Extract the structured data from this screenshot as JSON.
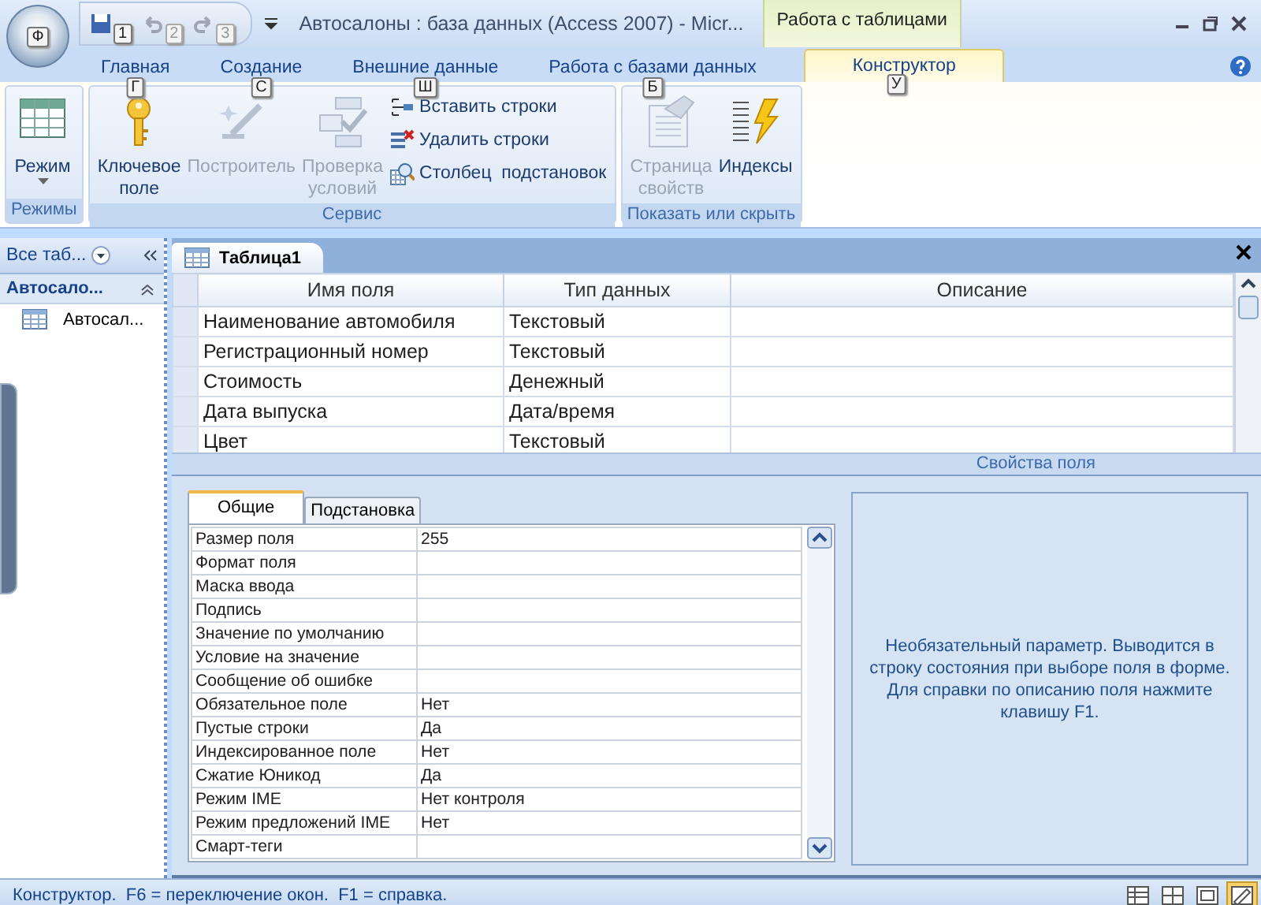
{
  "title_bar": {
    "office_keytip": "Ф",
    "quick_access": [
      {
        "keytip": "1",
        "disabled": false
      },
      {
        "keytip": "2",
        "disabled": true
      },
      {
        "keytip": "3",
        "disabled": true
      }
    ],
    "title": "Автосалоны : база данных (Access 2007) - Micr...",
    "context_tab": "Работа с таблицами"
  },
  "ribbon_tabs": [
    {
      "label": "Главная",
      "keytip": "Г",
      "selected": false
    },
    {
      "label": "Создание",
      "keytip": "С",
      "selected": false
    },
    {
      "label": "Внешние данные",
      "keytip": "Ш",
      "selected": false
    },
    {
      "label": "Работа с базами данных",
      "keytip": "Б",
      "selected": false
    },
    {
      "label": "Конструктор",
      "keytip": "У",
      "selected": true
    }
  ],
  "ribbon_groups": [
    {
      "name": "Режимы",
      "buttons": [
        {
          "kind": "dropdown",
          "label": "Режим",
          "disabled": false
        }
      ]
    },
    {
      "name": "Сервис",
      "buttons": [
        {
          "kind": "large",
          "label": "Ключевое поле",
          "disabled": false
        },
        {
          "kind": "large",
          "label": "Построитель",
          "disabled": true
        },
        {
          "kind": "large",
          "label": "Проверка условий",
          "disabled": true
        },
        {
          "kind": "small",
          "label": "Вставить строки",
          "disabled": false
        },
        {
          "kind": "small",
          "label": "Удалить строки",
          "disabled": false
        },
        {
          "kind": "small",
          "label": "Столбец  подстановок",
          "disabled": false
        }
      ]
    },
    {
      "name": "Показать или скрыть",
      "buttons": [
        {
          "kind": "large",
          "label": "Страница свойств",
          "disabled": true
        },
        {
          "kind": "large",
          "label": "Индексы",
          "disabled": false
        }
      ]
    }
  ],
  "nav_pane": {
    "header": "Все таб...",
    "group": "Автосало...",
    "items": [
      "Автосал..."
    ]
  },
  "document_tab": "Таблица1",
  "field_grid": {
    "columns": [
      "Имя поля",
      "Тип данных",
      "Описание"
    ],
    "rows": [
      {
        "name": "Наименование автомобиля",
        "type": "Текстовый"
      },
      {
        "name": "Регистрационный номер",
        "type": "Текстовый"
      },
      {
        "name": "Стоимость",
        "type": "Денежный"
      },
      {
        "name": "Дата выпуска",
        "type": "Дата/время"
      },
      {
        "name": "Цвет",
        "type": "Текстовый"
      }
    ]
  },
  "field_properties": {
    "title": "Свойства поля",
    "tabs": [
      {
        "label": "Общие",
        "selected": true
      },
      {
        "label": "Подстановка",
        "selected": false
      }
    ],
    "rows": [
      {
        "label": "Размер поля",
        "value": "255"
      },
      {
        "label": "Формат поля"
      },
      {
        "label": "Маска ввода"
      },
      {
        "label": "Подпись"
      },
      {
        "label": "Значение по умолчанию"
      },
      {
        "label": "Условие на значение"
      },
      {
        "label": "Сообщение об ошибке"
      },
      {
        "label": "Обязательное поле",
        "value": "Нет"
      },
      {
        "label": "Пустые строки",
        "value": "Да"
      },
      {
        "label": "Индексированное поле",
        "value": "Нет"
      },
      {
        "label": "Сжатие Юникод",
        "value": "Да"
      },
      {
        "label": "Режим IME",
        "value": "Нет контроля"
      },
      {
        "label": "Режим предложений IME",
        "value": "Нет"
      },
      {
        "label": "Смарт-теги"
      }
    ],
    "help": "Необязательный параметр.  Выводится в строку состояния при выборе поля в форме. Для справки по описанию поля нажмите клавишу F1."
  },
  "status_bar": {
    "text": "Конструктор.  F6 = переключение окон.  F1 = справка.",
    "views": [
      {
        "selected": false
      },
      {
        "selected": false
      },
      {
        "selected": false
      },
      {
        "selected": true
      }
    ]
  }
}
